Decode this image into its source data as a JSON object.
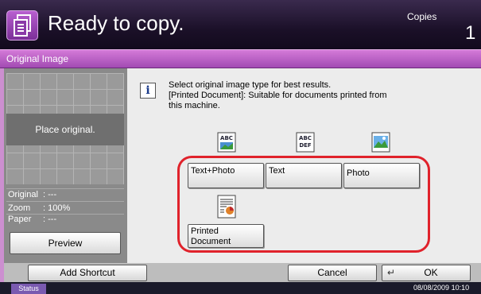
{
  "header": {
    "title": "Ready to copy.",
    "copies_label": "Copies",
    "copies_count": "1"
  },
  "tab": {
    "title": "Original Image"
  },
  "preview_panel": {
    "place_message": "Place original.",
    "original_label": "Original",
    "original_value": ": ---",
    "zoom_label": "Zoom",
    "zoom_value": ": 100%",
    "paper_label": "Paper",
    "paper_value": ": ---",
    "preview_button": "Preview"
  },
  "message": {
    "line1": "Select original image type for best results.",
    "line2": "[Printed Document]: Suitable for documents printed from",
    "line3": "this machine."
  },
  "options": {
    "text_photo": "Text+Photo",
    "text": "Text",
    "photo": "Photo",
    "printed_document_line1": "Printed",
    "printed_document_line2": "Document",
    "icon_abc": "ABC",
    "icon_def": "DEF"
  },
  "footer": {
    "add_shortcut": "Add Shortcut",
    "cancel": "Cancel",
    "ok": "OK"
  },
  "status": {
    "tab": "Status",
    "date": "08/08/2009",
    "time": "10:10"
  },
  "icons": [
    "copy-machine-icon",
    "info-icon",
    "text-photo-icon",
    "text-icon",
    "photo-icon",
    "printed-document-icon",
    "enter-icon"
  ],
  "colors": {
    "accent": "#a24bb3",
    "highlight": "#e0222b",
    "header_bg": "#1b1028"
  }
}
